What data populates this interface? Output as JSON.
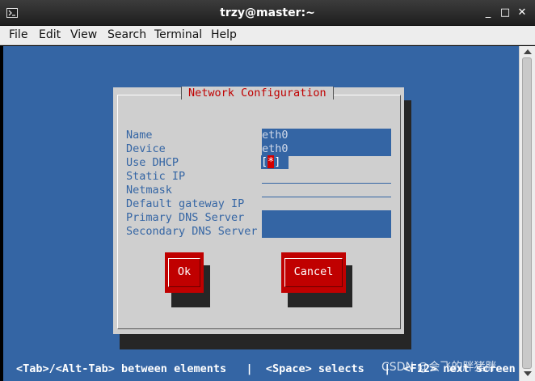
{
  "window": {
    "title": "trzy@master:~",
    "controls": [
      "✕",
      "_",
      "□"
    ]
  },
  "menubar": [
    "File",
    "Edit",
    "View",
    "Search",
    "Terminal",
    "Help"
  ],
  "dialog": {
    "title": "Network Configuration",
    "fields": [
      {
        "label": "Name",
        "value": "eth0"
      },
      {
        "label": "Device",
        "value": "eth0"
      },
      {
        "label": "Use DHCP",
        "checkbox_left": "[",
        "checkbox_mark": "*",
        "checkbox_right": "]"
      },
      {
        "label": "Static IP",
        "value": ""
      },
      {
        "label": "Netmask",
        "value": ""
      },
      {
        "label": "Default gateway IP",
        "value": ""
      },
      {
        "label": "Primary DNS Server",
        "value": ""
      },
      {
        "label": "Secondary DNS Server",
        "value": ""
      }
    ],
    "ok_label": "Ok",
    "cancel_label": "Cancel"
  },
  "statusbar": "<Tab>/<Alt-Tab> between elements   |  <Space> selects   |  <F12> next screen",
  "watermark": "CSDN @会飞的胖猪胖",
  "colors": {
    "terminal_bg": "#3465a4",
    "dialog_bg": "#cfcfcf",
    "accent_red": "#c00000"
  }
}
